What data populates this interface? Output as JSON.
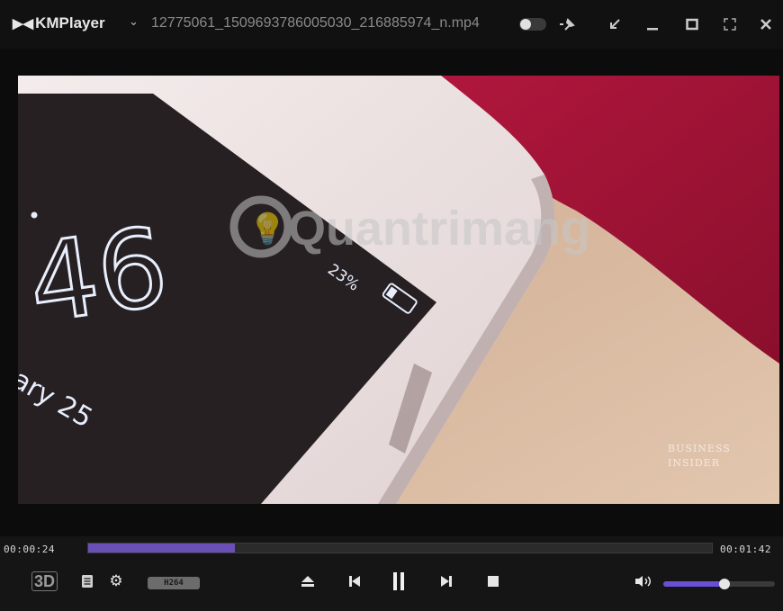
{
  "window": {
    "app_name": "KMPlayer",
    "filename": "12775061_1509693786005030_216885974_n.mp4"
  },
  "video": {
    "watermark": "Quantrimang",
    "clock": "46",
    "date_fragment": "ary 25",
    "battery": "23%",
    "brand": [
      "BUSINESS",
      "INSIDER"
    ]
  },
  "playback": {
    "current_time": "00:00:24",
    "total_time": "00:01:42",
    "progress": 0.235
  },
  "controls": {
    "three_d_label": "3D",
    "codec_label": "H264",
    "volume": 0.55
  },
  "colors": {
    "accent": "#6a4fb6",
    "background": "#151515"
  }
}
